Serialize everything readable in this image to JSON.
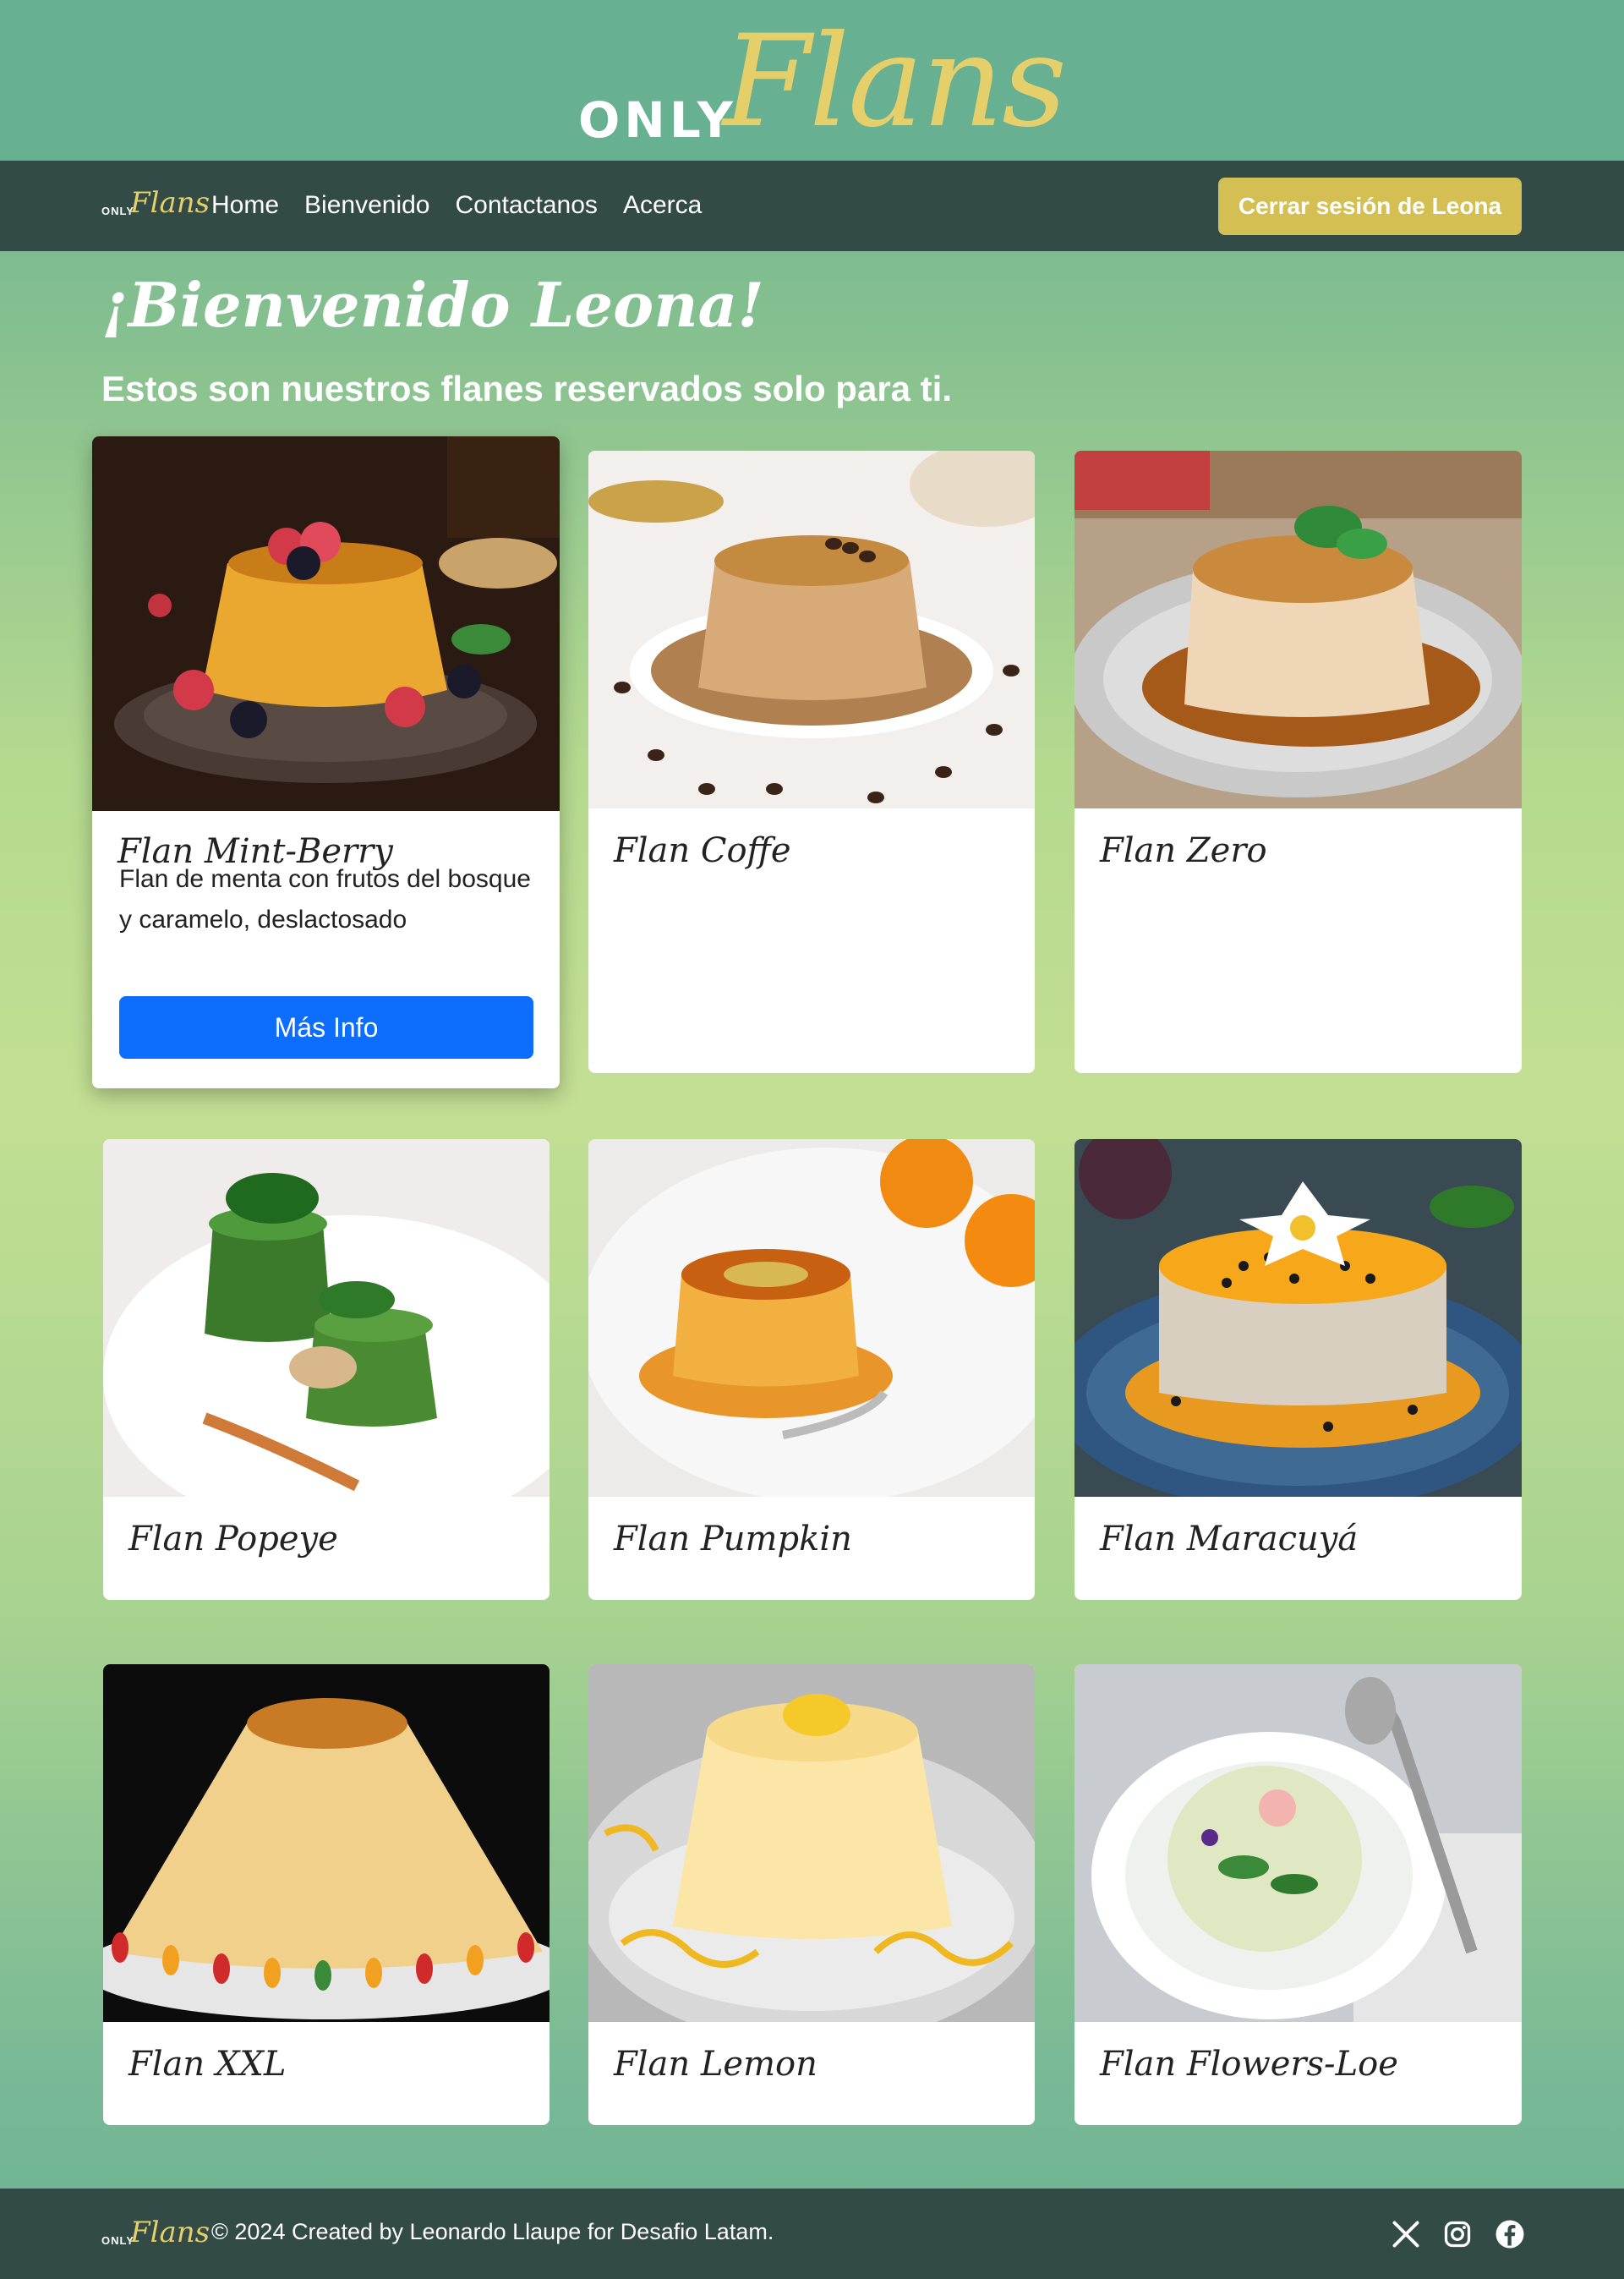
{
  "brand": {
    "only": "ONLY",
    "flans": "Flans"
  },
  "nav": {
    "links": [
      "Home",
      "Bienvenido",
      "Contactanos",
      "Acerca"
    ],
    "logout_label": "Cerrar sesión de Leona"
  },
  "welcome": {
    "title": "¡Bienvenido Leona!",
    "subtitle": "Estos son nuestros flanes reservados solo para ti."
  },
  "cards": [
    {
      "title": "Flan Mint-Berry",
      "description": "Flan de menta con frutos del bosque y caramelo, deslactosado",
      "button": "Más Info"
    },
    {
      "title": "Flan Coffe"
    },
    {
      "title": "Flan Zero"
    },
    {
      "title": "Flan Popeye"
    },
    {
      "title": "Flan Pumpkin"
    },
    {
      "title": "Flan Maracuyá"
    },
    {
      "title": "Flan XXL"
    },
    {
      "title": "Flan Lemon"
    },
    {
      "title": "Flan Flowers-Loe"
    }
  ],
  "footer": {
    "text": "© 2024 Created by Leonardo Llaupe for Desafio Latam.",
    "social": [
      "x-icon",
      "instagram-icon",
      "facebook-icon"
    ]
  },
  "colors": {
    "brand_gold": "#e4cf6a",
    "nav_bg": "#334b46",
    "primary": "#0d6efd",
    "logout": "#d4bf52"
  }
}
